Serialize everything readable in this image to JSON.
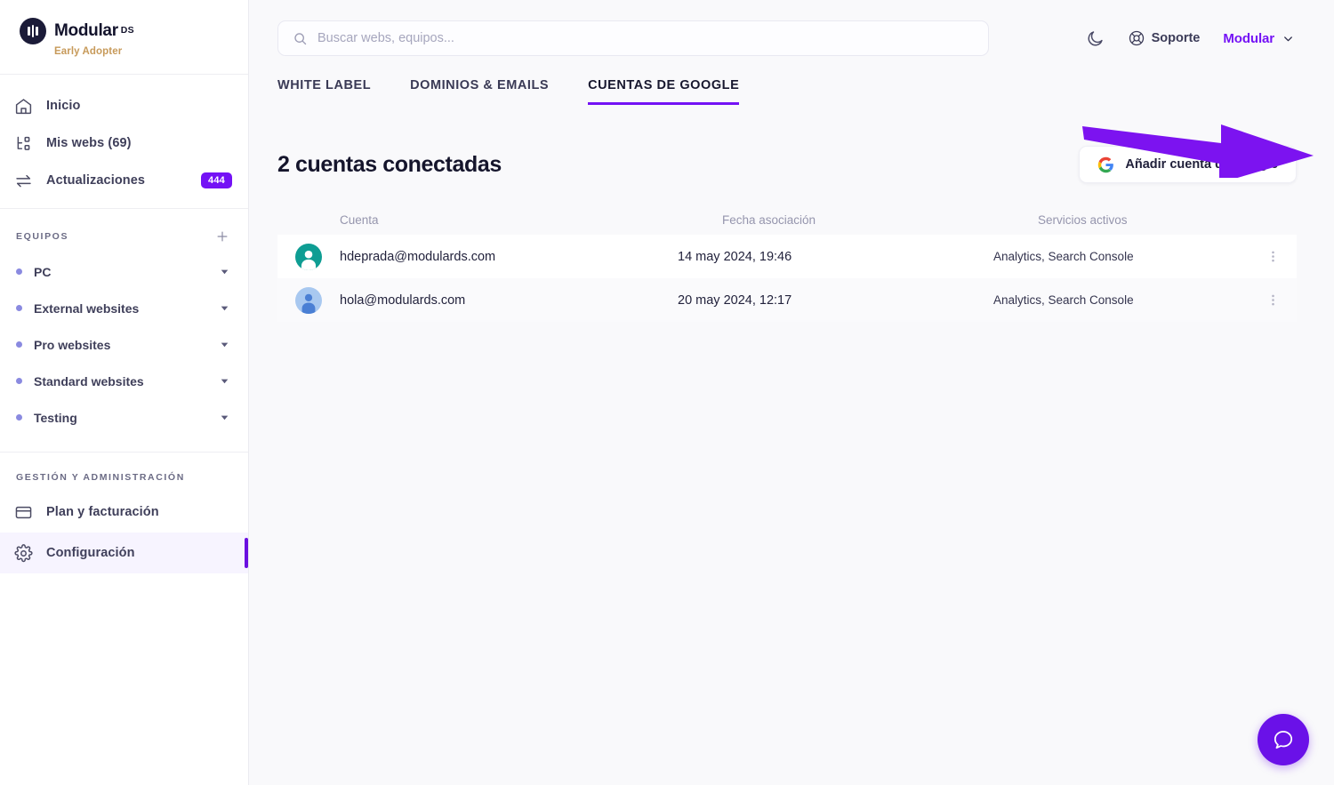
{
  "brand": {
    "name": "Modular",
    "superscript": "DS",
    "tagline": "Early Adopter",
    "logo_icon": "modular-bars-logo",
    "logo_bg": "#1b1b38",
    "tagline_color": "#c79a5a"
  },
  "sidebar": {
    "nav": [
      {
        "label": "Inicio",
        "icon": "home-icon",
        "badge": null
      },
      {
        "label": "Mis webs (69)",
        "icon": "sitemap-icon",
        "badge": null
      },
      {
        "label": "Actualizaciones",
        "icon": "exchange-arrows-icon",
        "badge": "444"
      }
    ],
    "teams_section": {
      "title": "EQUIPOS",
      "add_icon": "plus-icon",
      "items": [
        {
          "label": "PC",
          "dot_color": "#8a8ae0",
          "caret": "chevron-down-icon"
        },
        {
          "label": "External websites",
          "dot_color": "#8a8ae0",
          "caret": "chevron-down-icon"
        },
        {
          "label": "Pro websites",
          "dot_color": "#8a8ae0",
          "caret": "chevron-down-icon"
        },
        {
          "label": "Standard websites",
          "dot_color": "#8a8ae0",
          "caret": "chevron-down-icon"
        },
        {
          "label": "Testing",
          "dot_color": "#8a8ae0",
          "caret": "chevron-down-icon"
        }
      ]
    },
    "admin_section": {
      "title": "GESTIÓN Y ADMINISTRACIÓN",
      "items": [
        {
          "label": "Plan y facturación",
          "icon": "credit-card-icon",
          "active": false
        },
        {
          "label": "Configuración",
          "icon": "gear-icon",
          "active": true
        }
      ]
    }
  },
  "topbar": {
    "search": {
      "placeholder": "Buscar webs, equipos...",
      "value": "",
      "icon": "search-icon"
    },
    "dark_mode_icon": "moon-icon",
    "support": {
      "label": "Soporte",
      "icon": "lifebuoy-icon"
    },
    "user": {
      "name": "Modular",
      "caret": "chevron-down-icon"
    }
  },
  "tabs": [
    {
      "label": "WHITE LABEL",
      "active": false
    },
    {
      "label": "DOMINIOS & EMAILS",
      "active": false
    },
    {
      "label": "CUENTAS DE GOOGLE",
      "active": true
    }
  ],
  "page": {
    "title": "2 cuentas conectadas",
    "add_button": {
      "label": "Añadir cuenta de Google",
      "icon": "google-g-icon"
    }
  },
  "table": {
    "columns": [
      "Cuenta",
      "Fecha asociación",
      "Servicios activos"
    ],
    "rows": [
      {
        "account": "hdeprada@modulards.com",
        "date": "14 may 2024, 19:46",
        "services": "Analytics, Search Console",
        "avatar_bg": "#0e9d93",
        "avatar_fg": "#ffffff",
        "menu_icon": "kebab-menu-icon"
      },
      {
        "account": "hola@modulards.com",
        "date": "20 may 2024, 12:17",
        "services": "Analytics, Search Console",
        "avatar_bg": "#a8c8f0",
        "avatar_fg": "#4a7fd4",
        "menu_icon": "kebab-menu-icon"
      }
    ]
  },
  "annotation": {
    "type": "arrow",
    "color": "#7c13f0",
    "points_to": "add-google-account-button"
  },
  "chat": {
    "icon": "chat-bubble-icon",
    "color": "#6a11e8"
  },
  "theme": {
    "accent": "#7412f5",
    "background": "#f9f9fb",
    "sidebar_bg": "#ffffff",
    "text": "#22223c"
  }
}
